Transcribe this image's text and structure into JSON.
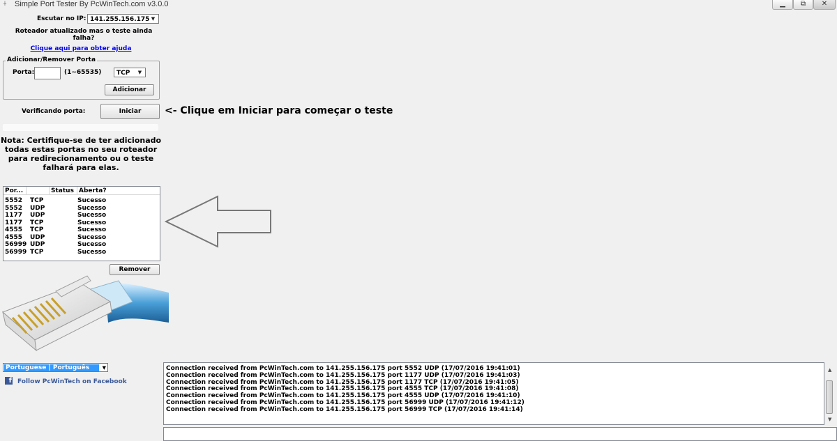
{
  "window": {
    "title": "Simple Port Tester By PcWinTech.com v3.0.0",
    "minimize_glyph": "▁",
    "maximize_glyph": "⧉",
    "close_glyph": "✕",
    "app_icon_glyph": "⍭"
  },
  "listen": {
    "label": "Escutar no IP:",
    "ip_value": "141.255.156.175",
    "arrow": "▼"
  },
  "router_note": {
    "line1": "Roteador atualizado mas o teste ainda",
    "line2": "falha?",
    "help_link": "Clique aqui para obter ajuda"
  },
  "port_group": {
    "legend": "Adicionar/Remover Porta",
    "port_label": "Porta:",
    "port_value": "",
    "range_hint": "(1~65535)",
    "protocol_value": "TCP",
    "arrow": "▼",
    "add_button": "Adicionar"
  },
  "verify": {
    "label": "Verificando porta:",
    "start_button": "Iniciar",
    "hint": "<- Clique em Iniciar para começar o teste"
  },
  "warning": {
    "line1": "Nota: Certifique-se de ter adicionado",
    "line2": "todas estas portas no seu roteador",
    "line3": "para redirecionamento ou o teste",
    "line4": "falhará para elas."
  },
  "ports_table": {
    "columns": [
      "Por...",
      "",
      "Status",
      "Aberta?"
    ],
    "rows": [
      {
        "port": "5552",
        "proto": "TCP",
        "status": "",
        "open": "Sucesso"
      },
      {
        "port": "5552",
        "proto": "UDP",
        "status": "",
        "open": "Sucesso"
      },
      {
        "port": "1177",
        "proto": "UDP",
        "status": "",
        "open": "Sucesso"
      },
      {
        "port": "1177",
        "proto": "TCP",
        "status": "",
        "open": "Sucesso"
      },
      {
        "port": "4555",
        "proto": "TCP",
        "status": "",
        "open": "Sucesso"
      },
      {
        "port": "4555",
        "proto": "UDP",
        "status": "",
        "open": "Sucesso"
      },
      {
        "port": "56999",
        "proto": "UDP",
        "status": "",
        "open": "Sucesso"
      },
      {
        "port": "56999",
        "proto": "TCP",
        "status": "",
        "open": "Sucesso"
      }
    ],
    "remove_button": "Remover"
  },
  "language": {
    "selected": "Portuguese | Português",
    "arrow": "▼"
  },
  "facebook": {
    "icon_glyph": "f",
    "link": "Follow PcWinTech on Facebook",
    "color": "#3b5998"
  },
  "log": {
    "lines": [
      "Connection received from PcWinTech.com to 141.255.156.175 port 5552 UDP (17/07/2016 19:41:01)",
      "Connection received from PcWinTech.com to 141.255.156.175 port 1177 UDP (17/07/2016 19:41:03)",
      "Connection received from PcWinTech.com to 141.255.156.175 port 1177 TCP (17/07/2016 19:41:05)",
      "Connection received from PcWinTech.com to 141.255.156.175 port 4555 TCP (17/07/2016 19:41:08)",
      "Connection received from PcWinTech.com to 141.255.156.175 port 4555 UDP (17/07/2016 19:41:10)",
      "Connection received from PcWinTech.com to 141.255.156.175 port 56999 UDP (17/07/2016 19:41:12)",
      "Connection received from PcWinTech.com to 141.255.156.175 port 56999 TCP (17/07/2016 19:41:14)"
    ],
    "scroll_up_glyph": "▲",
    "scroll_down_glyph": "▼"
  },
  "colors": {
    "window_bg": "#f0f0f0",
    "link": "#0000ee",
    "selection": "#3399ff",
    "cable_blue": "#4a9fd8"
  }
}
